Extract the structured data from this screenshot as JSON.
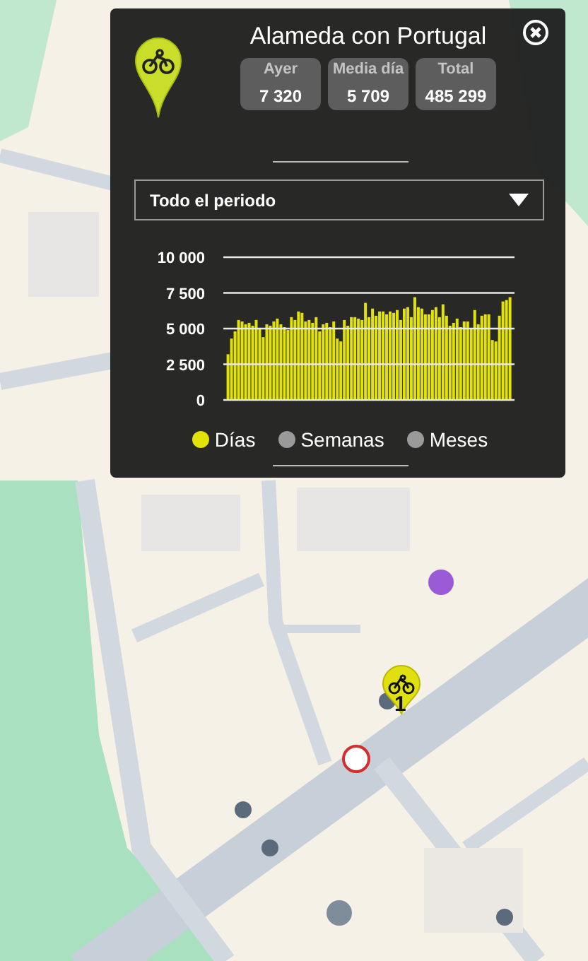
{
  "popup": {
    "title": "Alameda con Portugal",
    "stats": [
      {
        "label": "Ayer",
        "value": "7 320"
      },
      {
        "label": "Media día",
        "value": "5 709"
      },
      {
        "label": "Total",
        "value": "485 299"
      }
    ],
    "period_select": {
      "value": "Todo el periodo"
    },
    "chart_data": {
      "type": "bar",
      "grid": true,
      "ylim": [
        0,
        10000
      ],
      "yticks": [
        {
          "value": 0,
          "label": "0"
        },
        {
          "value": 2500,
          "label": "2 500"
        },
        {
          "value": 5000,
          "label": "5 000"
        },
        {
          "value": 7500,
          "label": "7 500"
        },
        {
          "value": 10000,
          "label": "10 000"
        }
      ],
      "series": [
        {
          "color": "#e2e204",
          "values": [
            3200,
            4300,
            4800,
            5600,
            5500,
            5300,
            5400,
            5200,
            5600,
            5000,
            4400,
            5300,
            5200,
            5500,
            5700,
            5300,
            5100,
            4900,
            5800,
            5600,
            6200,
            6100,
            5500,
            5600,
            5400,
            5800,
            4800,
            5300,
            5400,
            5100,
            5500,
            4300,
            4100,
            5600,
            5200,
            5800,
            5800,
            5700,
            5600,
            6800,
            5800,
            6400,
            5900,
            6200,
            6200,
            6000,
            6200,
            6100,
            6300,
            5600,
            6400,
            6500,
            5800,
            7200,
            6500,
            6400,
            6000,
            6000,
            6300,
            6500,
            5800,
            6700,
            5900,
            5200,
            5400,
            5700,
            5100,
            5500,
            5500,
            5000,
            6300,
            5300,
            5900,
            6000,
            6000,
            4200,
            4100,
            5900,
            6900,
            7000,
            7200
          ]
        }
      ]
    },
    "legend": [
      {
        "label": "Días",
        "selected": true
      },
      {
        "label": "Semanas",
        "selected": false
      },
      {
        "label": "Meses",
        "selected": false
      }
    ]
  },
  "map": {
    "markers": [
      {
        "label": "1"
      }
    ]
  }
}
